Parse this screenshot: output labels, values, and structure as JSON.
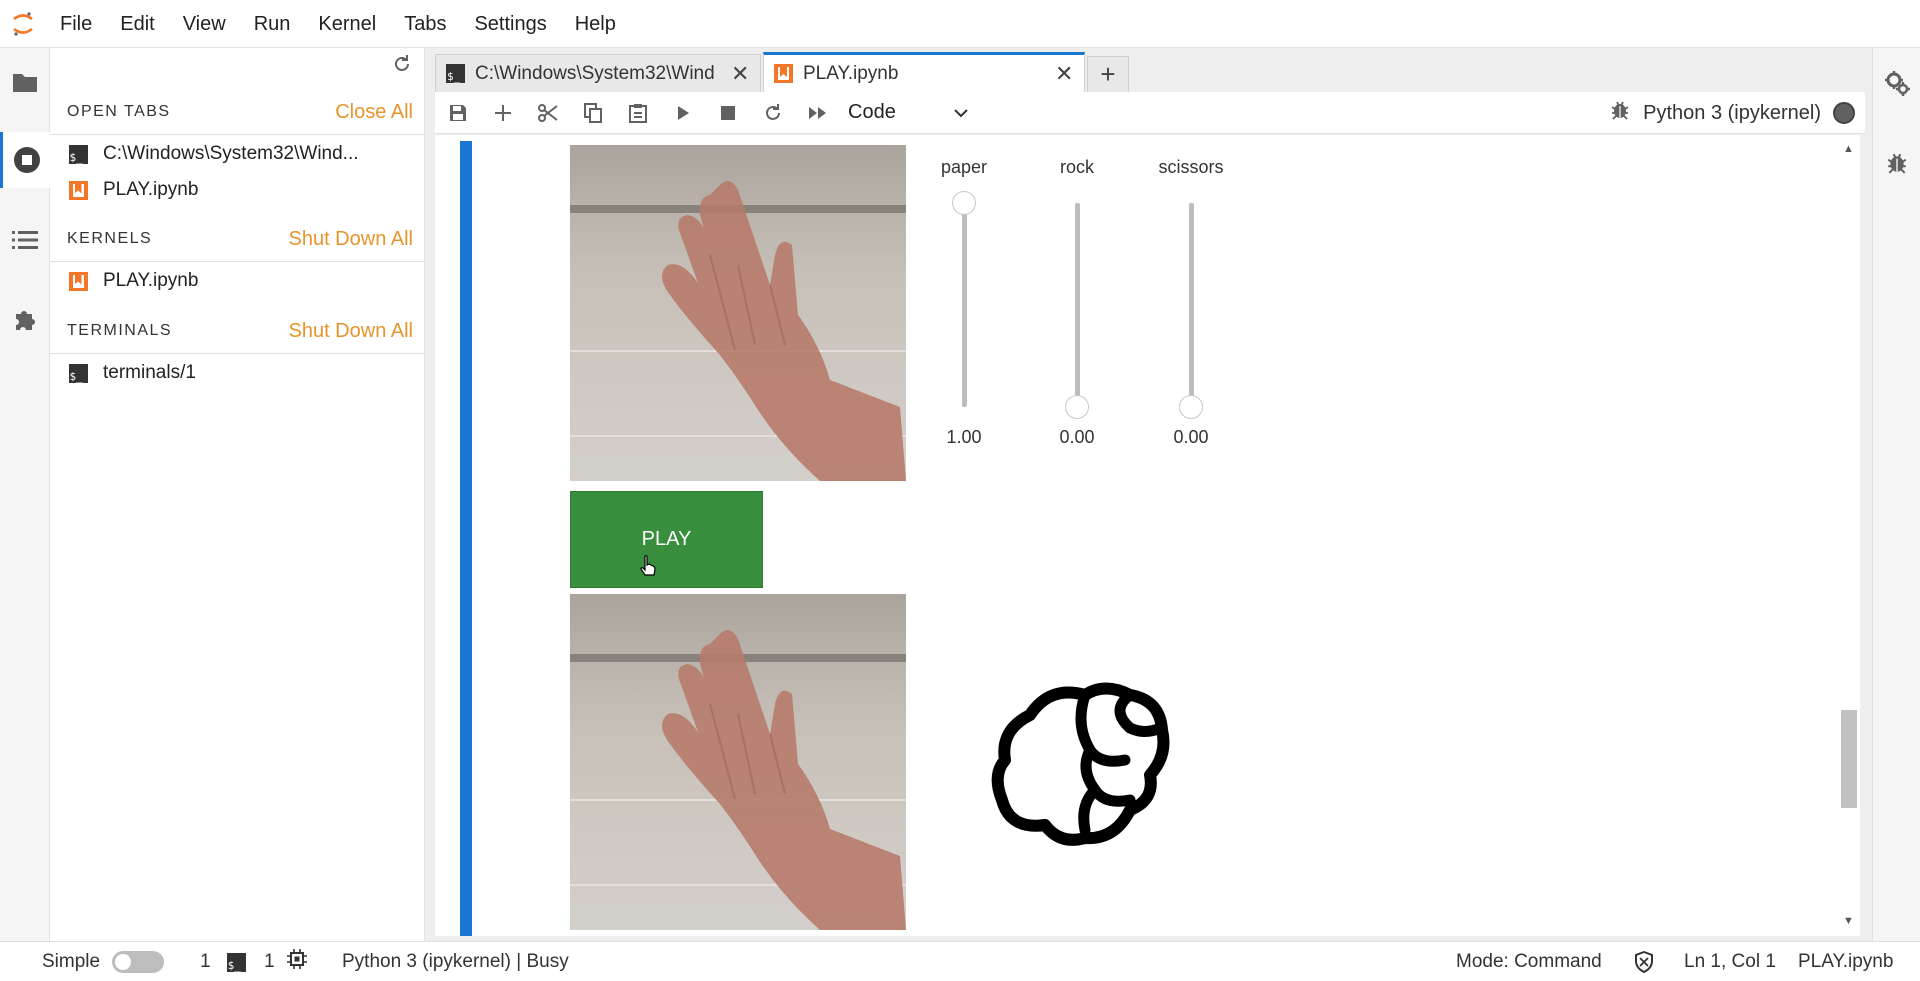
{
  "menubar": {
    "items": [
      "File",
      "Edit",
      "View",
      "Run",
      "Kernel",
      "Tabs",
      "Settings",
      "Help"
    ]
  },
  "sidebar_left": {
    "icons": [
      "folder-icon",
      "running-icon",
      "toc-icon",
      "extension-icon"
    ]
  },
  "running_panel": {
    "open_tabs": {
      "title": "OPEN TABS",
      "action": "Close All",
      "items": [
        {
          "label": "C:\\Windows\\System32\\Wind...",
          "icon": "terminal-icon"
        },
        {
          "label": "PLAY.ipynb",
          "icon": "notebook-icon"
        }
      ]
    },
    "kernels": {
      "title": "KERNELS",
      "action": "Shut Down All",
      "items": [
        {
          "label": "PLAY.ipynb",
          "icon": "notebook-icon"
        }
      ]
    },
    "terminals": {
      "title": "TERMINALS",
      "action": "Shut Down All",
      "items": [
        {
          "label": "terminals/1",
          "icon": "terminal-icon"
        }
      ]
    }
  },
  "tabs": [
    {
      "label": "C:\\Windows\\System32\\Wind",
      "icon": "terminal-icon",
      "active": false
    },
    {
      "label": "PLAY.ipynb",
      "icon": "notebook-icon",
      "active": true
    }
  ],
  "toolbar": {
    "buttons": [
      "save-icon",
      "add-cell-icon",
      "cut-icon",
      "copy-icon",
      "paste-icon",
      "run-icon",
      "stop-icon",
      "restart-icon",
      "fast-forward-icon"
    ],
    "cell_type": "Code",
    "kernel_name": "Python 3 (ipykernel)",
    "kernel_status": "busy"
  },
  "output": {
    "play_button": "PLAY",
    "sliders": [
      {
        "name": "paper",
        "value": "1.00",
        "level": 1.0
      },
      {
        "name": "rock",
        "value": "0.00",
        "level": 0.0
      },
      {
        "name": "scissors",
        "value": "0.00",
        "level": 0.0
      }
    ],
    "images": [
      "webcam-hand-paper",
      "webcam-hand-paper",
      "rock-fist-icon"
    ]
  },
  "statusbar": {
    "mode_label": "Simple",
    "simple_on": false,
    "terminal_count": "1",
    "kernel_count": "1",
    "kernel_status": "Python 3 (ipykernel) | Busy",
    "mode": "Mode: Command",
    "position": "Ln 1, Col 1",
    "filename": "PLAY.ipynb"
  },
  "colors": {
    "accent": "#1976d2",
    "brand": "#f37726",
    "action": "#e8942b",
    "play_button": "#388e3c"
  }
}
